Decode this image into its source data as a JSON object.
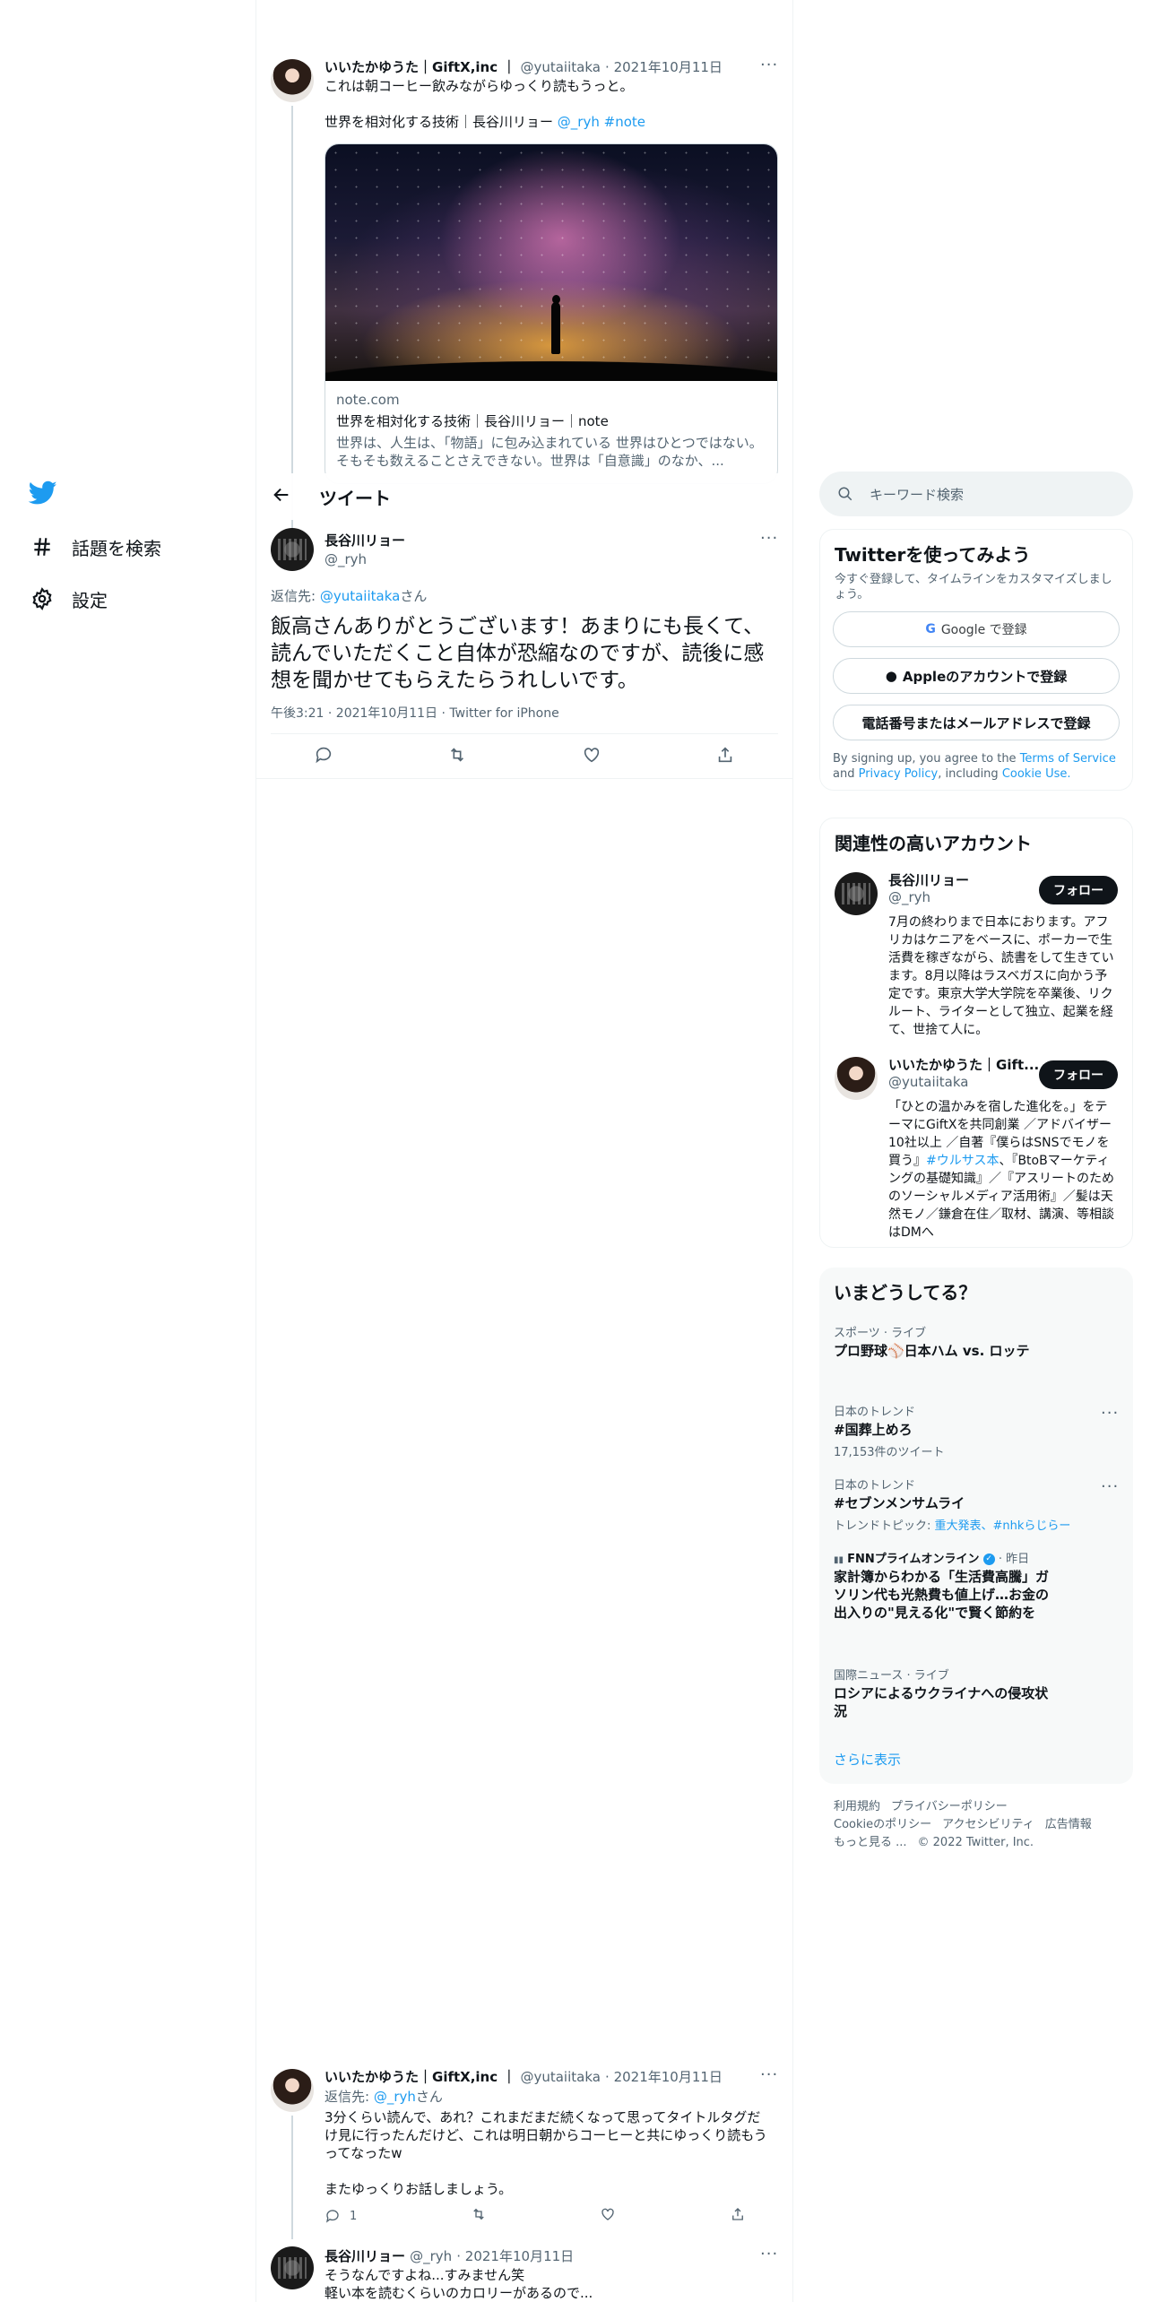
{
  "sidebar": {
    "nav": [
      {
        "label": "話題を検索",
        "icon": "hashtag-icon"
      },
      {
        "label": "設定",
        "icon": "gear-icon"
      }
    ]
  },
  "top_tweet": {
    "name": "いいたかゆうた｜GiftX,inc ｜",
    "handle": "@yutaiitaka",
    "date": "· 2021年10月11日",
    "text_line1": "これは朝コーヒー飲みながらゆっくり読もうっと。",
    "text_line2": "世界を相対化する技術｜長谷川リョー",
    "mention": "@_ryh",
    "hashtag": "#note",
    "card": {
      "domain": "note.com",
      "title": "世界を相対化する技術｜長谷川リョー｜note",
      "desc": "世界は、人生は、「物語」に包み込まれている 世界はひとつではない。 そもそも数えることさえできない。世界は「自意識」のなか、..."
    }
  },
  "header": {
    "title": "ツイート",
    "back_icon": "back-arrow-icon"
  },
  "main_tweet": {
    "name": "長谷川リョー",
    "handle": "@_ryh",
    "reply_prefix": "返信先: ",
    "reply_to": "@yutaiitaka",
    "reply_suffix": "さん",
    "text": "飯高さんありがとうございます！あまりにも長くて、読んでいただくこと自体が恐縮なのですが、読後に感想を聞かせてもらえたらうれしいです。",
    "meta": "午後3:21 · 2021年10月11日 · Twitter for iPhone"
  },
  "reply1": {
    "name": "いいたかゆうた｜GiftX,inc ｜",
    "handle": "@yutaiitaka",
    "date": "· 2021年10月11日",
    "reply_prefix": "返信先: ",
    "reply_to": "@_ryh",
    "reply_suffix": "さん",
    "text1": "3分くらい読んで、あれ？これまだまだ続くなって思ってタイトルタグだけ見に行ったんだけど、これは明日朝からコーヒーと共にゆっくり読もうってなったw",
    "text2": "またゆっくりお話しましょう。",
    "reply_count": "1"
  },
  "reply2": {
    "name": "長谷川リョー",
    "handle": "@_ryh",
    "date": "· 2021年10月11日",
    "text1": "そうなんですよね...すみません笑",
    "text2": "軽い本を読むくらいのカロリーがあるので..."
  },
  "search": {
    "placeholder": "キーワード検索"
  },
  "signup_panel": {
    "title": "Twitterを使ってみよう",
    "subtitle": "今すぐ登録して、タイムラインをカスタマイズしましょう。",
    "google": "Google で登録",
    "apple": "Appleのアカウントで登録",
    "phone": "電話番号またはメールアドレスで登録",
    "terms_prefix": "By signing up, you agree to the ",
    "terms": "Terms of Service",
    "and": " and ",
    "privacy": "Privacy Policy",
    "including": ", including ",
    "cookie": "Cookie Use."
  },
  "relevant": {
    "title": "関連性の高いアカウント",
    "accounts": [
      {
        "name": "長谷川リョー",
        "handle": "@_ryh",
        "follow": "フォロー",
        "bio": "7月の終わりまで日本におります。アフリカはケニアをベースに、ポーカーで生活費を稼ぎながら、読書をして生きています。8月以降はラスベガスに向かう予定です。東京大学大学院を卒業後、リクルート、ライターとして独立、起業を経て、世捨て人に。"
      },
      {
        "name": "いいたかゆうた｜Gift...",
        "handle": "@yutaiitaka",
        "follow": "フォロー",
        "bio_a": "「ひとの温かみを宿した進化を。」をテーマにGiftXを共同創業 ／アドバイザー10社以上 ／自著『僕らはSNSでモノを買う』",
        "bio_tag": "#ウルサス本",
        "bio_b": "、『BtoBマーケティングの基礎知識』／『アスリートのためのソーシャルメディア活用術』／髪は天然モノ／鎌倉在住／取材、講演、等相談はDMへ"
      }
    ]
  },
  "trends": {
    "title": "いまどうしてる？",
    "items": [
      {
        "context": "スポーツ · ライブ",
        "name": "プロ野球⚾日本ハム vs. ロッテ"
      },
      {
        "context": "日本のトレンド",
        "name": "#国葬上めろ",
        "sub": "17,153件のツイート"
      },
      {
        "context": "日本のトレンド",
        "name": "#セブンメンサムライ",
        "sub_prefix": "トレンドトピック: ",
        "sub_links": "重大発表、#nhkらじらー"
      },
      {
        "context_name": "FNNプライムオンライン",
        "context_time": " · 昨日",
        "name": "家計簿からわかる「生活費高騰」ガソリン代も光熱費も値上げ…お金の出入りの\"見える化\"で賢く節約を"
      },
      {
        "context": "国際ニュース · ライブ",
        "name": "ロシアによるウクライナへの侵攻状況"
      }
    ],
    "show_more": "さらに表示"
  },
  "footer": {
    "line1": [
      "利用規約",
      "プライバシーポリシー"
    ],
    "line2": [
      "Cookieのポリシー",
      "アクセシビリティ",
      "広告情報"
    ],
    "line3": [
      "もっと見る ...",
      "© 2022 Twitter, Inc."
    ]
  },
  "colors": {
    "accent": "#1d9bf0",
    "text": "#0f1419",
    "muted": "#536471"
  }
}
